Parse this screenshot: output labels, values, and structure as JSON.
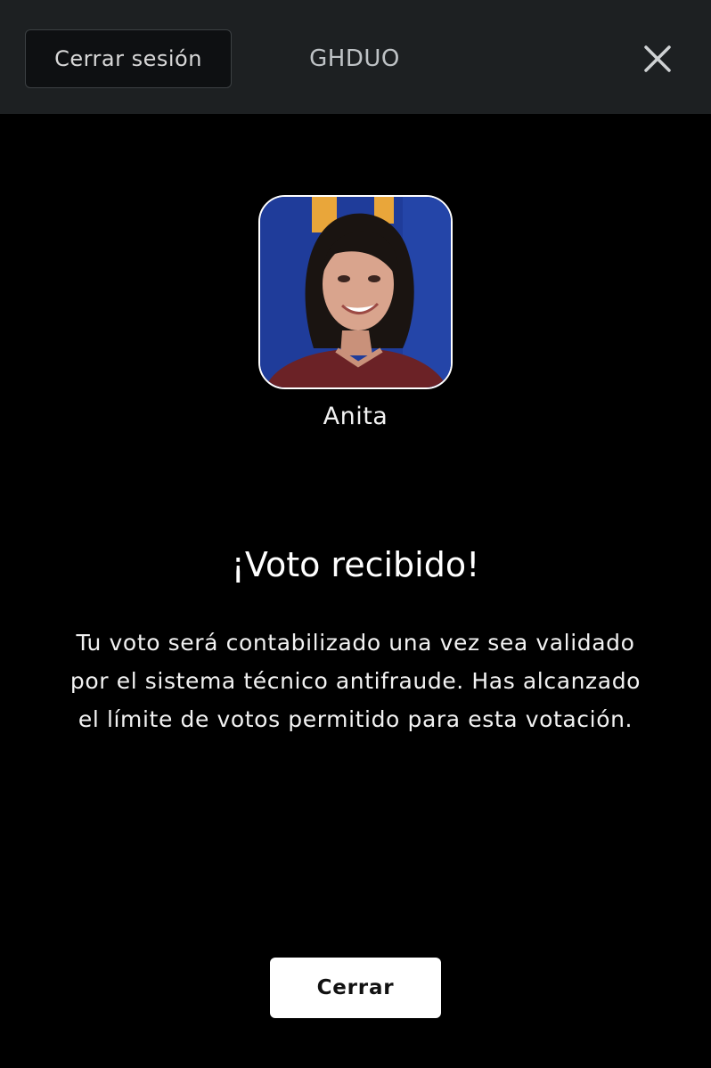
{
  "header": {
    "logout_label": "Cerrar sesión",
    "title": "GHDUO",
    "close_icon": "close-icon"
  },
  "candidate": {
    "name": "Anita",
    "photo": "candidate-photo",
    "photo_background_colors": [
      "#1f3c9a",
      "#e9a63a"
    ]
  },
  "confirmation": {
    "title": "¡Voto recibido!",
    "message": "Tu voto será contabilizado una vez sea validado por el sistema técnico antifraude. Has alcanzado el límite de votos permitido para esta votación."
  },
  "footer": {
    "close_label": "Cerrar"
  },
  "colors": {
    "background": "#000000",
    "header_background": "#1d2022",
    "button_primary": "#ffffff",
    "text": "#ffffff"
  }
}
